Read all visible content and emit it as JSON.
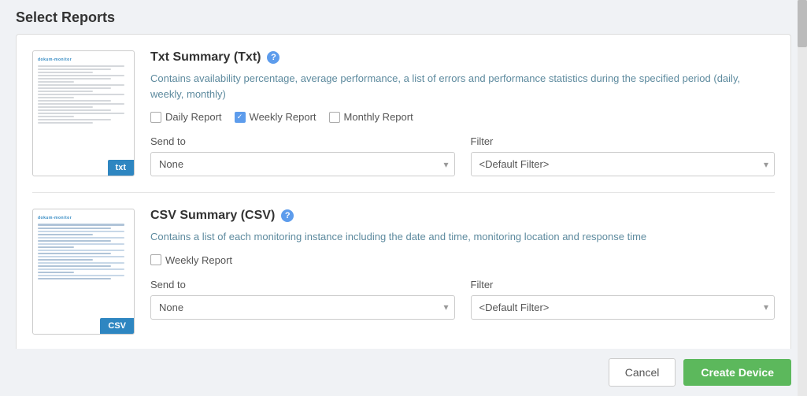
{
  "pageTitle": "Select Reports",
  "reports": [
    {
      "id": "txt",
      "title": "Txt Summary (Txt)",
      "badgeLabel": "txt",
      "description": "Contains availability percentage, average performance, a list of errors and performance statistics during the specified period (daily, weekly, monthly)",
      "checkboxes": [
        {
          "id": "daily",
          "label": "Daily Report",
          "checked": false
        },
        {
          "id": "weekly",
          "label": "Weekly Report",
          "checked": true
        },
        {
          "id": "monthly",
          "label": "Monthly Report",
          "checked": false
        }
      ],
      "sendToLabel": "Send to",
      "sendToValue": "None",
      "filterLabel": "Filter",
      "filterValue": "<Default Filter>"
    },
    {
      "id": "csv",
      "title": "CSV Summary (CSV)",
      "badgeLabel": "CSV",
      "description": "Contains a list of each monitoring instance including the date and time, monitoring location and response time",
      "checkboxes": [
        {
          "id": "weekly2",
          "label": "Weekly Report",
          "checked": false
        }
      ],
      "sendToLabel": "Send to",
      "sendToValue": "None",
      "filterLabel": "Filter",
      "filterValue": "<Default Filter>"
    }
  ],
  "footer": {
    "cancelLabel": "Cancel",
    "createLabel": "Create Device"
  }
}
